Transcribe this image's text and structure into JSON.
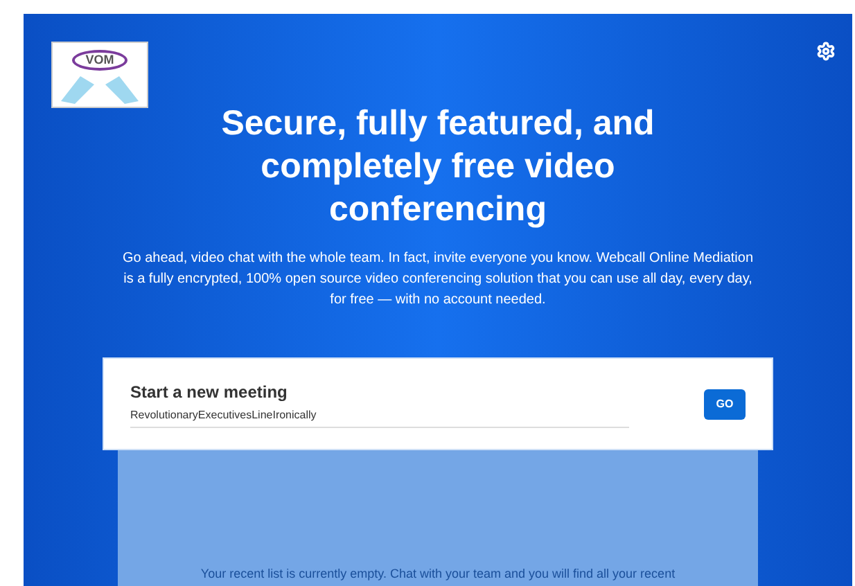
{
  "logo": {
    "text": "VOM"
  },
  "hero": {
    "title": "Secure, fully featured, and completely free video conferencing",
    "description": "Go ahead, video chat with the whole team. In fact, invite everyone you know. Webcall Online Mediation is a fully encrypted, 100% open source video conferencing solution that you can use all day, every day, for free — with no account needed."
  },
  "meeting": {
    "title": "Start a new meeting",
    "value": "RevolutionaryExecutivesLineIronically",
    "button": "GO"
  },
  "recent": {
    "empty_text": "Your recent list is currently empty. Chat with your team and you will find all your recent"
  }
}
